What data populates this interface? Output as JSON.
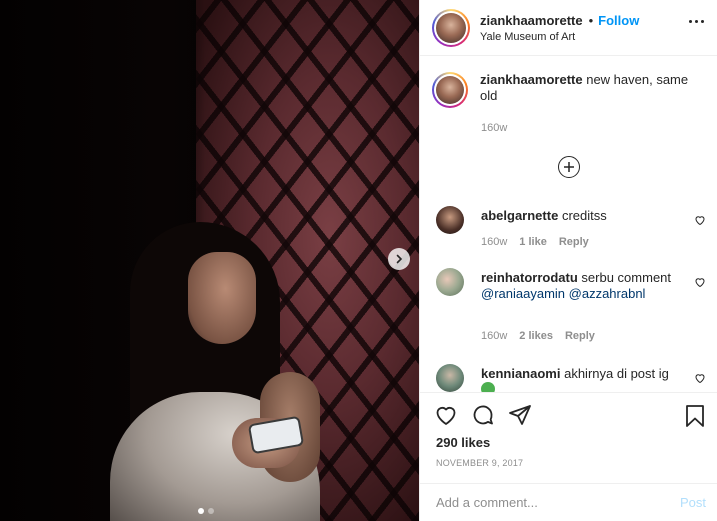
{
  "post": {
    "username": "ziankhaamorette",
    "separator": "•",
    "follow_label": "Follow",
    "location": "Yale Museum of Art",
    "caption_username": "ziankhaamorette",
    "caption_text": "new haven, same old",
    "caption_time": "160w",
    "likes": "290 likes",
    "date": "NOVEMBER 9, 2017",
    "carousel": {
      "current": 1,
      "total": 2
    }
  },
  "comments": [
    {
      "username": "abelgarnette",
      "text": "creditss",
      "time": "160w",
      "likes": "1 like",
      "reply": "Reply"
    },
    {
      "username": "reinhatorrodatu",
      "text": "serbu comment",
      "mentions": [
        "@raniaayamin",
        "@azzahrabnl"
      ],
      "time": "160w",
      "likes": "2 likes",
      "reply": "Reply"
    },
    {
      "username": "kennianaomi",
      "text": "akhirnya di post ig"
    }
  ],
  "add_comment": {
    "placeholder": "Add a comment...",
    "post_label": "Post"
  },
  "icons": {
    "next": "chevron-right-icon",
    "more": "more-horizontal-icon",
    "load_more": "plus-circle-icon",
    "like": "heart-icon",
    "comment": "comment-icon",
    "share": "paper-plane-icon",
    "save": "bookmark-icon"
  },
  "colors": {
    "link": "#0095f6",
    "muted": "#8e8e8e",
    "post_disabled": "#b2dffc",
    "mention": "#00376b"
  }
}
